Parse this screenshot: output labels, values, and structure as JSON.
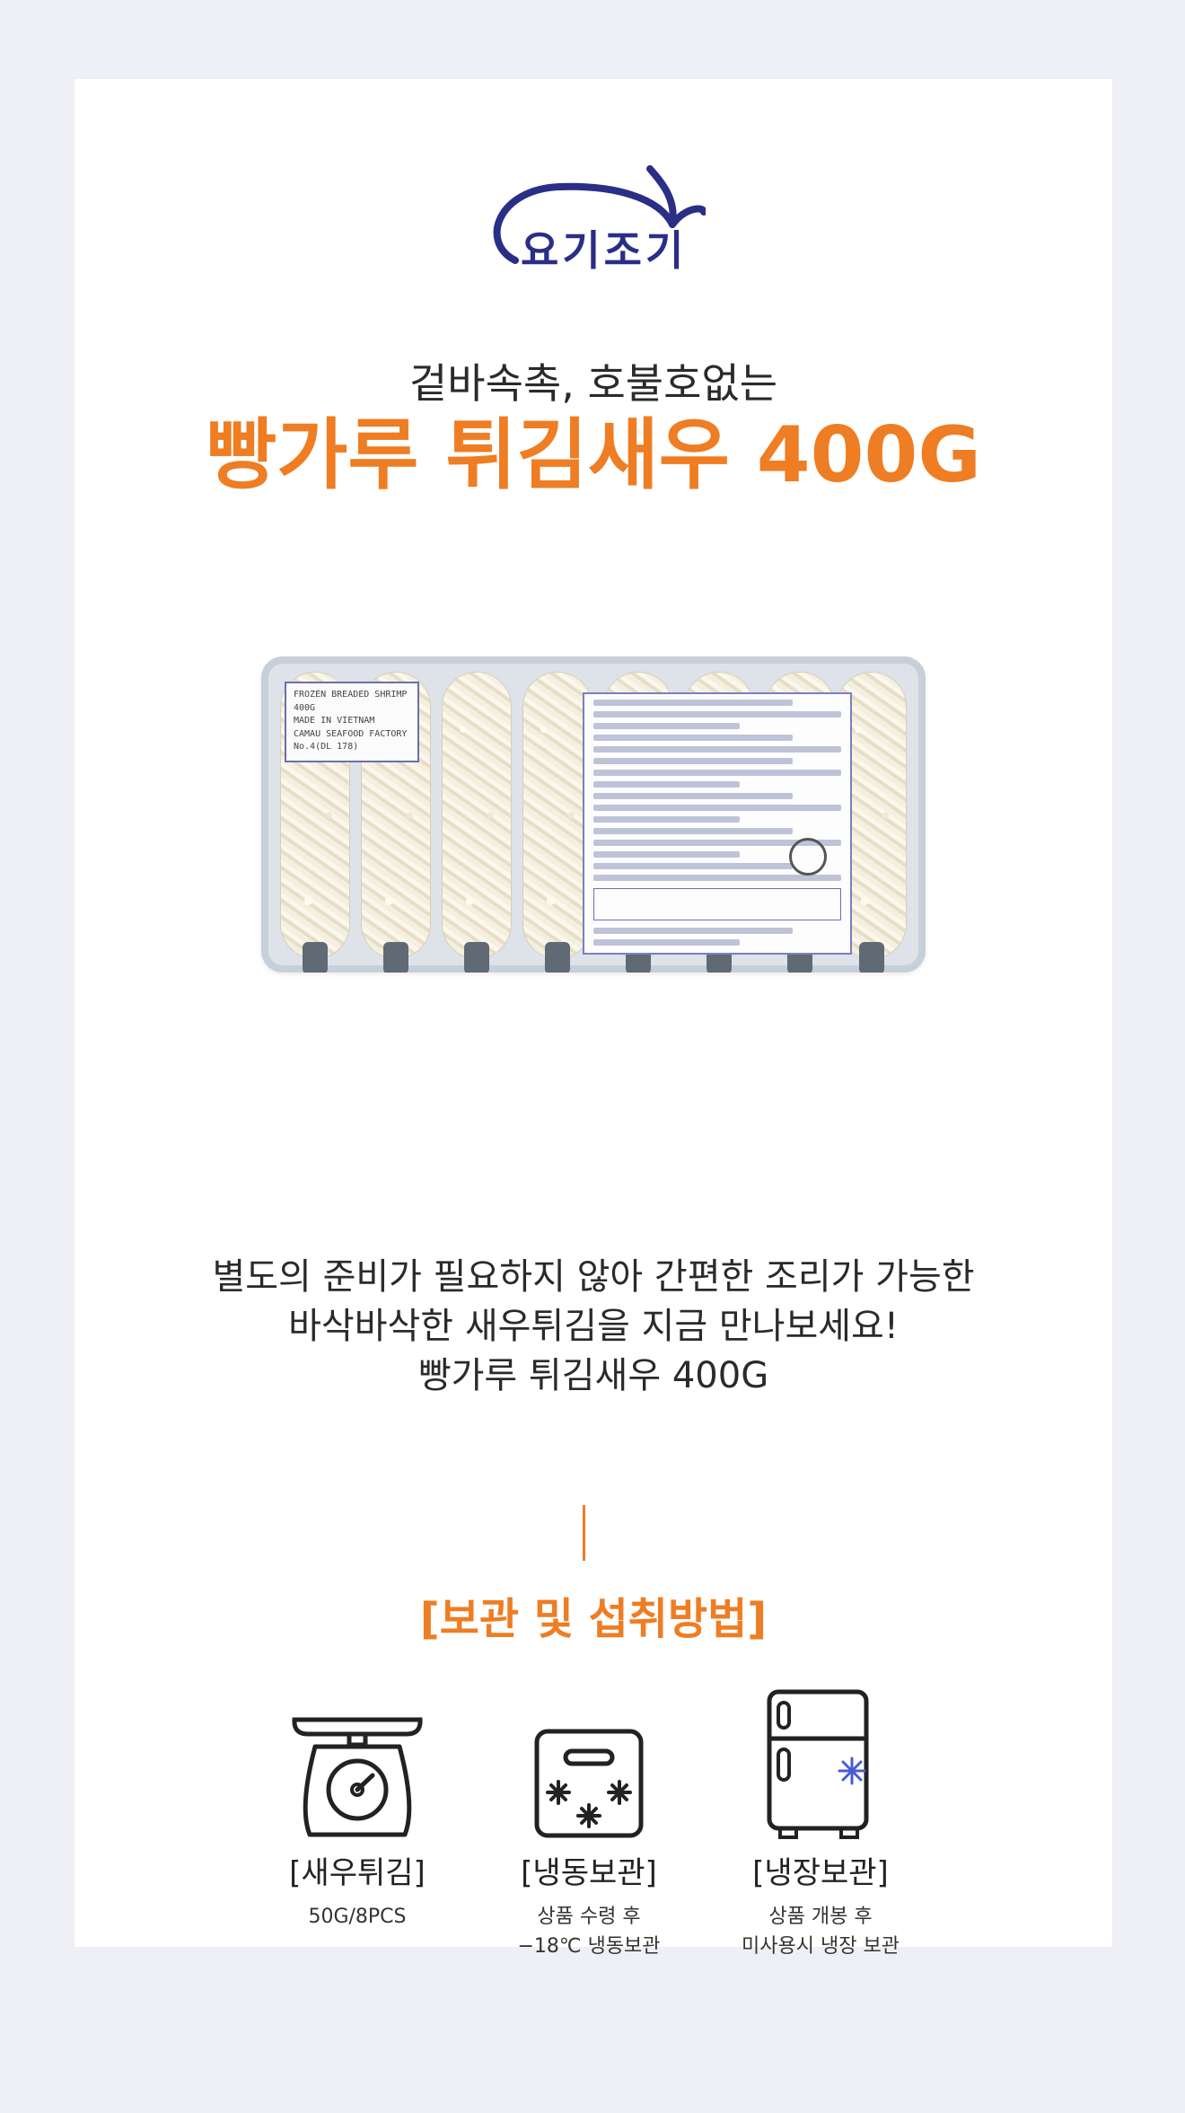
{
  "brand": {
    "name": "요기조기"
  },
  "header": {
    "subtitle": "겉바속촉, 호불호없는",
    "title": "빵가루 튀김새우 400G"
  },
  "product_image": {
    "tag_lines": [
      "FROZEN BREADED SHRIMP",
      "400G",
      "MADE IN VIETNAM",
      "CAMAU SEAFOOD FACTORY No.4(DL 178)"
    ]
  },
  "description": {
    "lines": [
      "별도의 준비가 필요하지 않아 간편한 조리가 가능한",
      "바삭바삭한 새우튀김을 지금 만나보세요!",
      "빵가루 튀김새우 400G"
    ]
  },
  "storage": {
    "title": "[보관 및 섭취방법]",
    "items": [
      {
        "label": "[새우튀김]",
        "notes": [
          "50G/8PCS"
        ],
        "icon": "scale-icon"
      },
      {
        "label": "[냉동보관]",
        "notes": [
          "상품 수령 후",
          "−18℃ 냉동보관"
        ],
        "icon": "freezer-box-icon"
      },
      {
        "label": "[냉장보관]",
        "notes": [
          "상품 개봉 후",
          "미사용시 냉장 보관"
        ],
        "icon": "refrigerator-icon"
      }
    ]
  },
  "colors": {
    "accent": "#ee7d23",
    "brand": "#2b2e86",
    "page_bg": "#eef0f6",
    "card_bg": "#ffffff"
  }
}
